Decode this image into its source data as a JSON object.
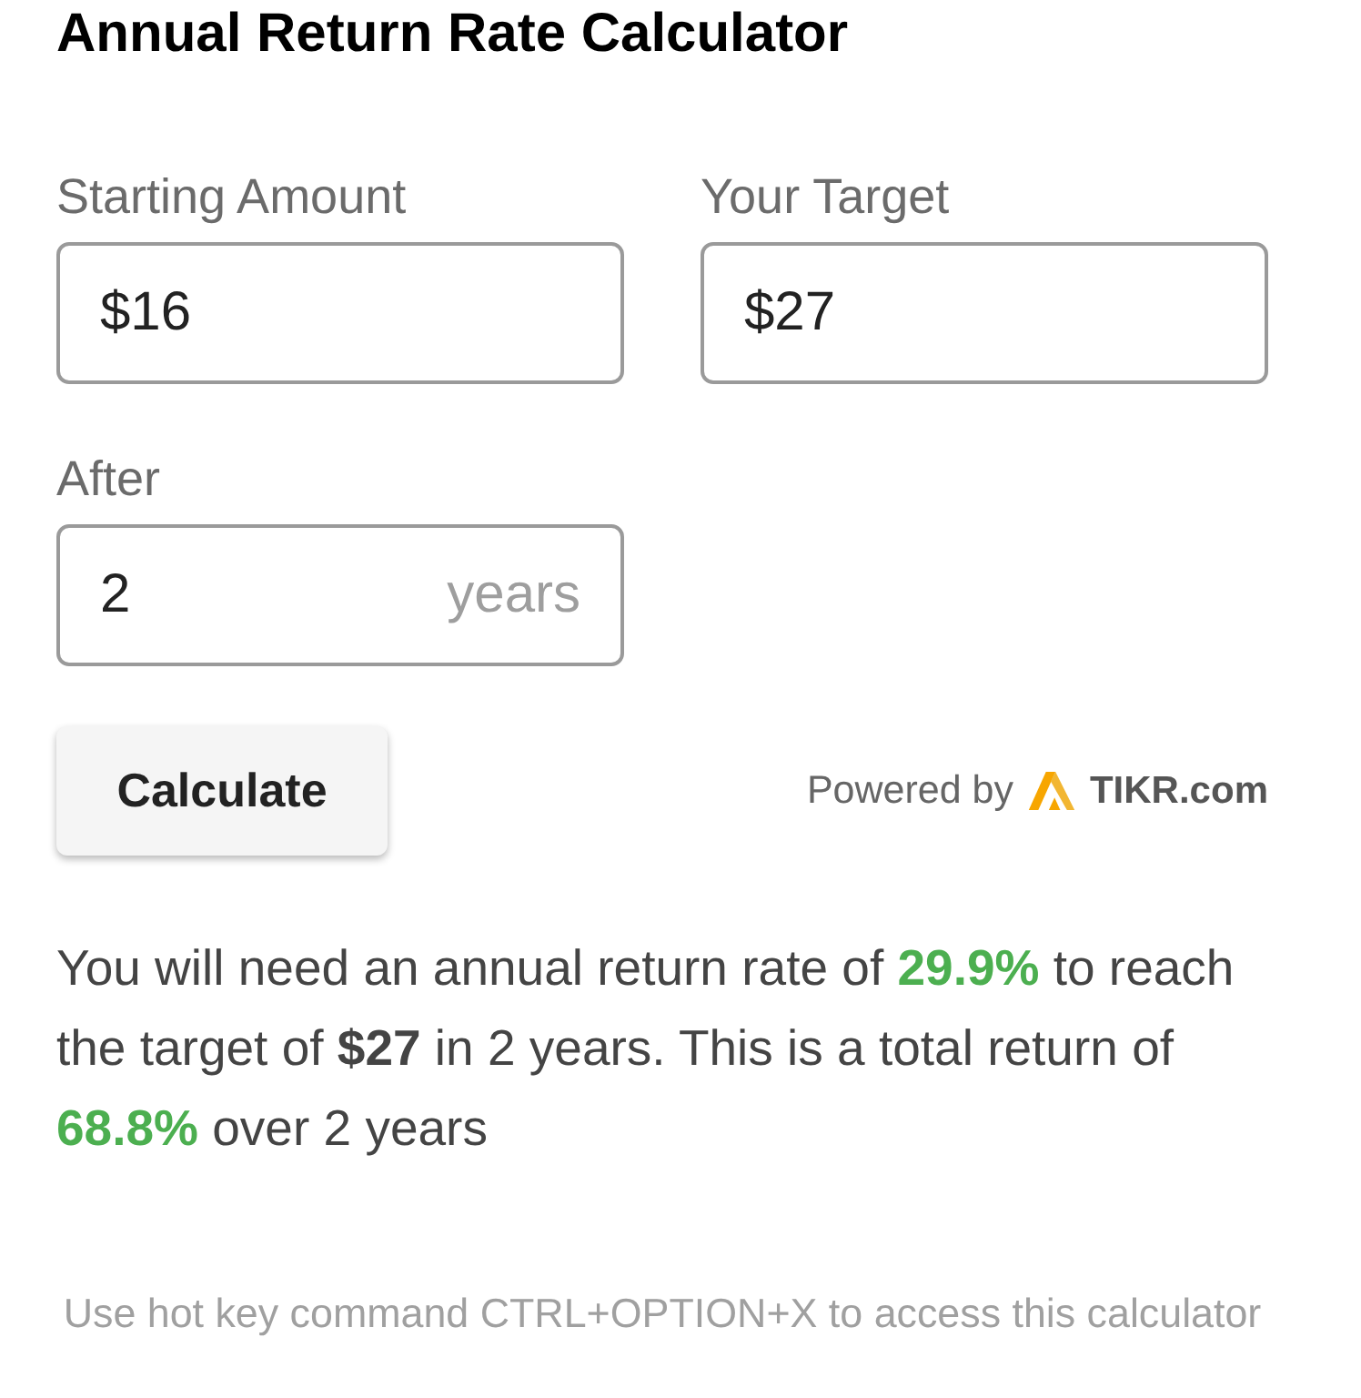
{
  "title": "Annual Return Rate Calculator",
  "fields": [
    {
      "label": "Starting Amount",
      "value": "$16"
    },
    {
      "label": "Your Target",
      "value": "$27"
    },
    {
      "label": "After",
      "value": "2",
      "suffix": "years"
    }
  ],
  "calculate_button": "Calculate",
  "powered_by": {
    "text": "Powered by",
    "brand": "TIKR.com"
  },
  "result": {
    "segments": [
      {
        "kind": "plain",
        "text": "You will need an annual return rate of "
      },
      {
        "kind": "highlight",
        "text": "29.9%"
      },
      {
        "kind": "plain",
        "text": " to reach the target of "
      },
      {
        "kind": "bold",
        "text": "$27"
      },
      {
        "kind": "plain",
        "text": " in 2 years. This is a total return of "
      },
      {
        "kind": "highlight",
        "text": "68.8%"
      },
      {
        "kind": "plain",
        "text": " over 2 years"
      }
    ]
  },
  "hint": "Use hot key command CTRL+OPTION+X to access this calculator"
}
